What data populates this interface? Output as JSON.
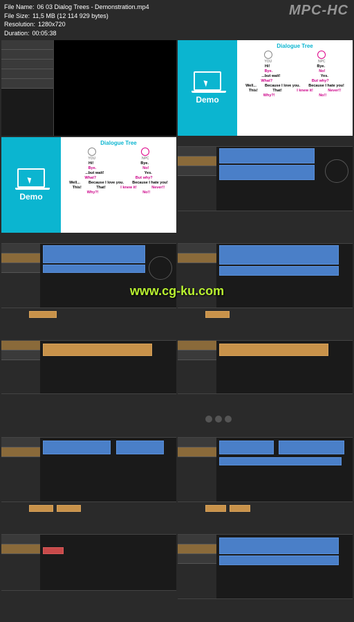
{
  "logo": "MPC-HC",
  "info": {
    "file_name_label": "File Name:",
    "file_name": "06 03 Dialog Trees - Demonstration.mp4",
    "file_size_label": "File Size:",
    "file_size": "11,5 MB (12 114 929 bytes)",
    "resolution_label": "Resolution:",
    "resolution": "1280x720",
    "duration_label": "Duration:",
    "duration": "00:05:38"
  },
  "demo": {
    "label": "Demo",
    "title": "Dialogue Tree",
    "you": "YOU",
    "npc": "NPC",
    "rows": [
      [
        "Hi!",
        "Bye."
      ],
      [
        "Bye.",
        "No!"
      ],
      [
        "...but wait!",
        "Yes."
      ],
      [
        "What?",
        "But why?"
      ],
      [
        "Well...",
        "Because I love you.",
        "Because I hate you!"
      ],
      [
        "This!",
        "That!",
        "I knew it!",
        "Never!!"
      ],
      [
        "Why?!",
        "No!!",
        "",
        ""
      ]
    ]
  },
  "watermark": "www.cg-ku.com"
}
